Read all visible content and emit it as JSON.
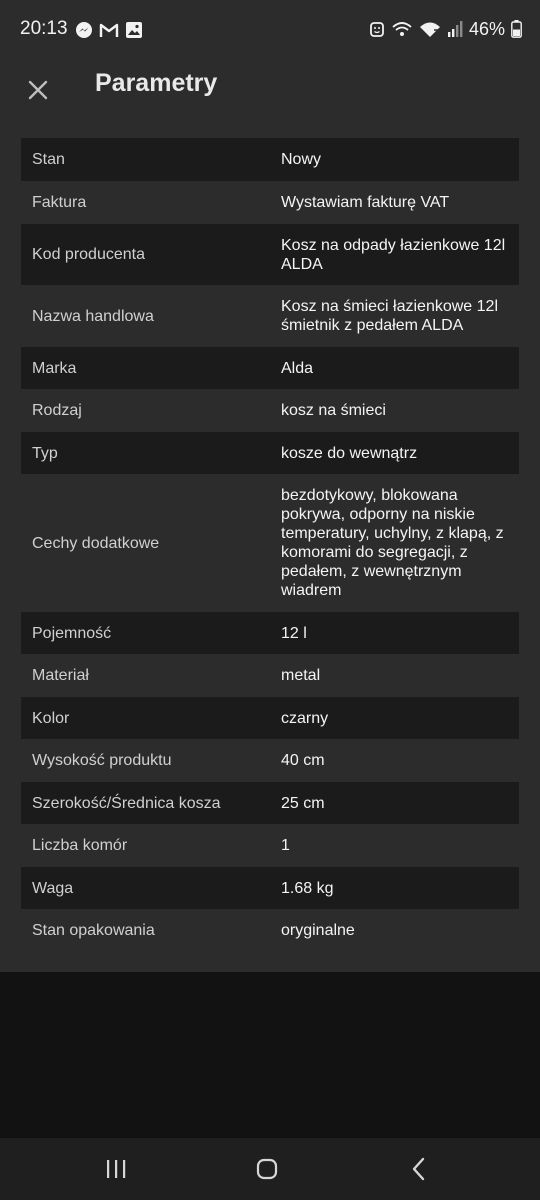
{
  "status_bar": {
    "time": "20:13",
    "left_icons": [
      "messenger-icon",
      "gmail-icon",
      "gallery-icon"
    ],
    "right_icons": [
      "alarm-icon",
      "wifi-calling-icon",
      "wifi-icon",
      "signal-icon"
    ],
    "battery_percent": "46%"
  },
  "app_bar": {
    "close_icon": "close-icon",
    "title": "Parametry"
  },
  "parameters": [
    {
      "label": "Stan",
      "value": "Nowy"
    },
    {
      "label": "Faktura",
      "value": "Wystawiam fakturę VAT"
    },
    {
      "label": "Kod producenta",
      "value": "Kosz na odpady łazienkowe 12l ALDA"
    },
    {
      "label": "Nazwa handlowa",
      "value": "Kosz na śmieci łazienkowe 12l śmietnik z pedałem ALDA"
    },
    {
      "label": "Marka",
      "value": "Alda"
    },
    {
      "label": "Rodzaj",
      "value": "kosz na śmieci"
    },
    {
      "label": "Typ",
      "value": "kosze do wewnątrz"
    },
    {
      "label": "Cechy dodatkowe",
      "value": "bezdotykowy, blokowana pokrywa, odporny na niskie temperatury, uchylny, z klapą, z komorami do segregacji, z pedałem, z wewnętrznym wiadrem"
    },
    {
      "label": "Pojemność",
      "value": "12 l"
    },
    {
      "label": "Materiał",
      "value": "metal"
    },
    {
      "label": "Kolor",
      "value": "czarny"
    },
    {
      "label": "Wysokość produktu",
      "value": "40 cm"
    },
    {
      "label": "Szerokość/Średnica kosza",
      "value": "25 cm"
    },
    {
      "label": "Liczba komór",
      "value": "1"
    },
    {
      "label": "Waga",
      "value": "1.68 kg"
    },
    {
      "label": "Stan opakowania",
      "value": "oryginalne"
    }
  ],
  "nav_bar": {
    "buttons": [
      "recent-apps-icon",
      "home-icon",
      "back-icon"
    ]
  },
  "colors": {
    "background": "#121212",
    "panel": "#2c2c2c",
    "row_dark": "#1b1b1b",
    "text": "#f4f4f4",
    "label_text": "#d0d0d0"
  }
}
